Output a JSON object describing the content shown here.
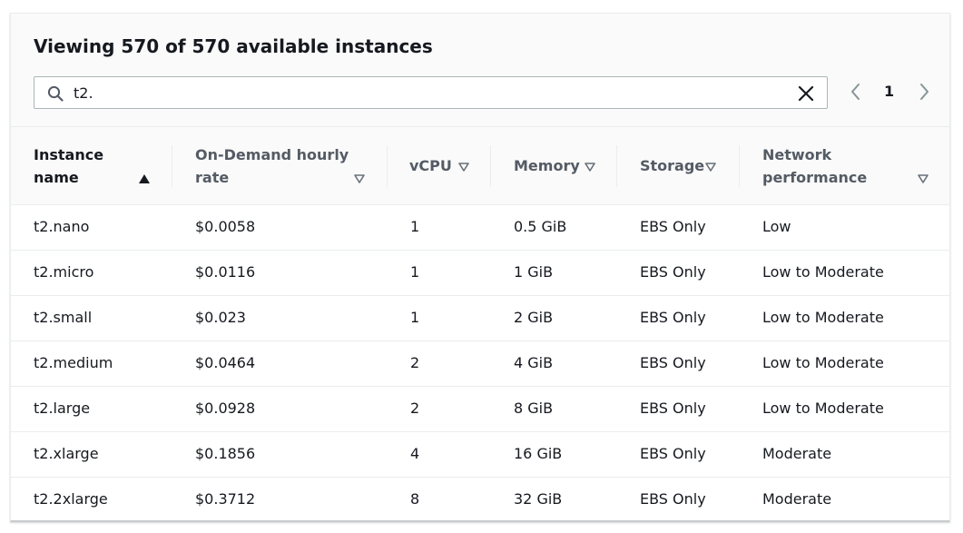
{
  "header": {
    "title": "Viewing 570 of 570 available instances"
  },
  "search": {
    "value": "t2.",
    "icon": "search-icon",
    "clear_icon": "close-icon"
  },
  "pagination": {
    "current_page": "1",
    "prev_icon": "chevron-left-icon",
    "next_icon": "chevron-right-icon"
  },
  "table": {
    "columns": [
      {
        "line1": "Instance",
        "line2": "name",
        "sort": "ascending"
      },
      {
        "line1": "On-Demand hourly",
        "line2": "rate",
        "sort": "none"
      },
      {
        "line1": "vCPU",
        "line2": "",
        "sort": "none"
      },
      {
        "line1": "Memory",
        "line2": "",
        "sort": "none"
      },
      {
        "line1": "Storage",
        "line2": "",
        "sort": "none"
      },
      {
        "line1": "Network",
        "line2": "performance",
        "sort": "none"
      }
    ],
    "rows": [
      [
        "t2.nano",
        "$0.0058",
        "1",
        "0.5 GiB",
        "EBS Only",
        "Low"
      ],
      [
        "t2.micro",
        "$0.0116",
        "1",
        "1 GiB",
        "EBS Only",
        "Low to Moderate"
      ],
      [
        "t2.small",
        "$0.023",
        "1",
        "2 GiB",
        "EBS Only",
        "Low to Moderate"
      ],
      [
        "t2.medium",
        "$0.0464",
        "2",
        "4 GiB",
        "EBS Only",
        "Low to Moderate"
      ],
      [
        "t2.large",
        "$0.0928",
        "2",
        "8 GiB",
        "EBS Only",
        "Low to Moderate"
      ],
      [
        "t2.xlarge",
        "$0.1856",
        "4",
        "16 GiB",
        "EBS Only",
        "Moderate"
      ],
      [
        "t2.2xlarge",
        "$0.3712",
        "8",
        "32 GiB",
        "EBS Only",
        "Moderate"
      ]
    ]
  }
}
